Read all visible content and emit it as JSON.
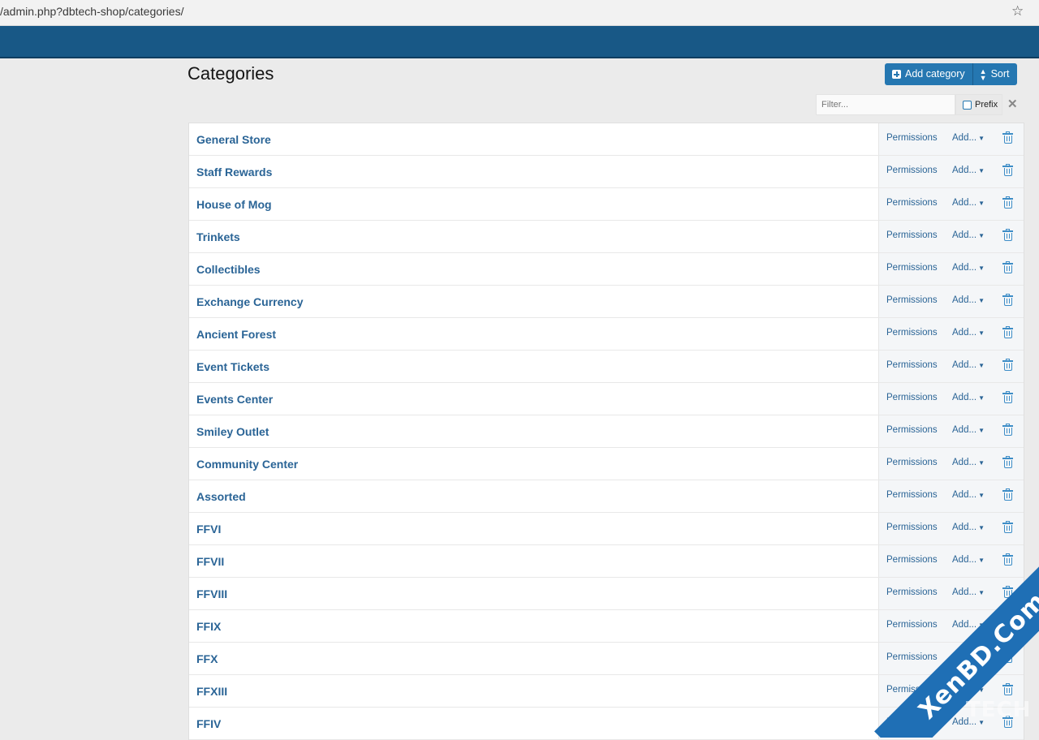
{
  "browser": {
    "url": "/admin.php?dbtech-shop/categories/"
  },
  "page": {
    "title": "Categories"
  },
  "toolbar": {
    "add_label": "Add category",
    "sort_label": "Sort"
  },
  "filter": {
    "placeholder": "Filter...",
    "prefix_label": "Prefix"
  },
  "row_actions": {
    "permissions": "Permissions",
    "add": "Add..."
  },
  "categories": [
    "General Store",
    "Staff Rewards",
    "House of Mog",
    "Trinkets",
    "Collectibles",
    "Exchange Currency",
    "Ancient Forest",
    "Event Tickets",
    "Events Center",
    "Smiley Outlet",
    "Community Center",
    "Assorted",
    "FFVI",
    "FFVII",
    "FFVIII",
    "FFIX",
    "FFX",
    "FFXIII",
    "FFIV"
  ],
  "watermark": {
    "text": "XenBD.Com",
    "sub": "TECH"
  },
  "colors": {
    "nav": "#185886",
    "accent": "#2577b1",
    "link": "#2a6496"
  }
}
